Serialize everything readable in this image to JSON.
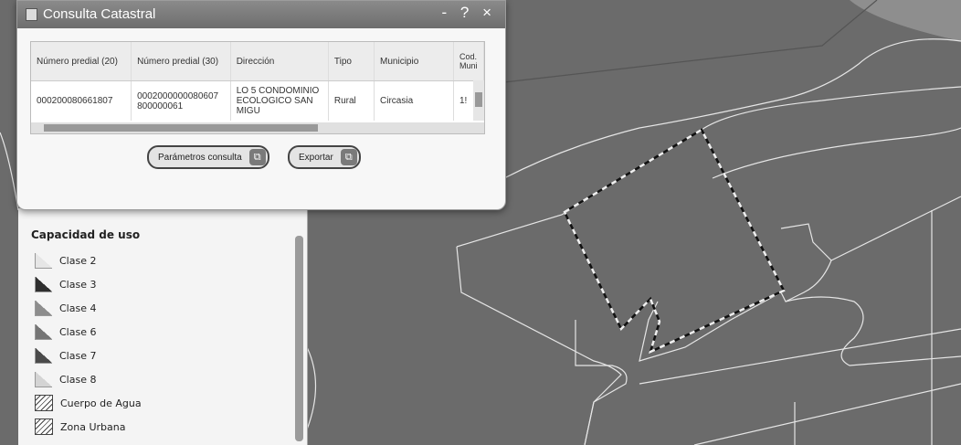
{
  "window": {
    "title": "Consulta Catastral",
    "controls": [
      "-",
      "?",
      "×"
    ]
  },
  "table": {
    "columns": [
      "Número predial (20)",
      "Número predial (30)",
      "Dirección",
      "Tipo",
      "Municipio",
      "Cod.\nMuni"
    ],
    "rows": [
      [
        "000200080661807",
        "0002000000080607 800000061",
        "LO 5 CONDOMINIO ECOLOGICO SAN MIGU",
        "Rural",
        "Circasia",
        "1!"
      ]
    ]
  },
  "buttons": {
    "params": "Parámetros consulta",
    "export": "Exportar"
  },
  "legend": {
    "title": "Capacidad de uso",
    "items": [
      {
        "label": "Clase 2",
        "color": "#e6e6e6",
        "pattern": "solid"
      },
      {
        "label": "Clase 3",
        "color": "#2e2e2e",
        "pattern": "solid"
      },
      {
        "label": "Clase 4",
        "color": "#8d8d8d",
        "pattern": "solid"
      },
      {
        "label": "Clase 6",
        "color": "#757575",
        "pattern": "solid"
      },
      {
        "label": "Clase 7",
        "color": "#4a4a4a",
        "pattern": "solid"
      },
      {
        "label": "Clase 8",
        "color": "#d4d4d4",
        "pattern": "solid"
      },
      {
        "label": "Cuerpo de Agua",
        "color": "#ffffff",
        "pattern": "hatch"
      },
      {
        "label": "Zona Urbana",
        "color": "#ffffff",
        "pattern": "hatch"
      }
    ]
  }
}
